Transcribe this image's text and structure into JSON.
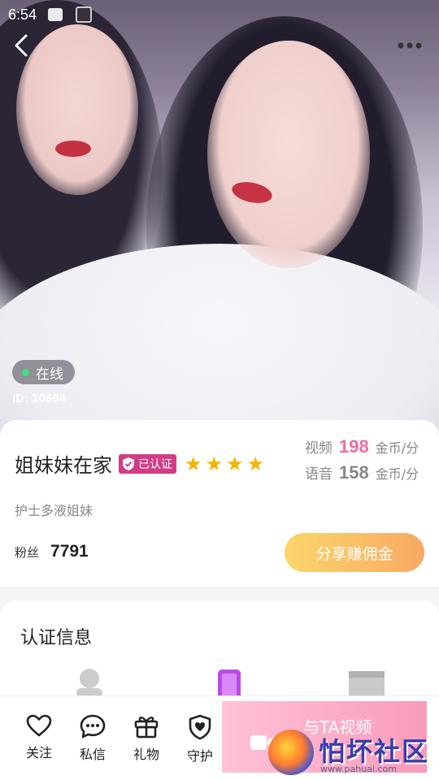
{
  "status_bar": {
    "time": "6:54"
  },
  "profile": {
    "online_status": "在线",
    "id_text": "ID: 10694",
    "name": "姐妹妹在家",
    "verified_label": "已认证",
    "star_count": 4,
    "stars": [
      "★",
      "★",
      "★",
      "★"
    ],
    "bio": "护士多液姐妹",
    "fans_label": "粉丝",
    "fans_count": "7791",
    "share_button": "分享赚佣金"
  },
  "pricing": {
    "video_label": "视频",
    "video_price": "198",
    "voice_label": "语音",
    "voice_price": "158",
    "unit": "金币/分"
  },
  "cert_section": {
    "title": "认证信息"
  },
  "bottom_bar": {
    "tabs": [
      {
        "label": "关注",
        "icon": "heart-icon"
      },
      {
        "label": "私信",
        "icon": "chat-bubble-icon"
      },
      {
        "label": "礼物",
        "icon": "gift-icon"
      },
      {
        "label": "守护",
        "icon": "shield-heart-icon"
      }
    ],
    "video_call_label": "与TA视频"
  },
  "watermark": {
    "text": "怕坏社区",
    "url": "www.pahuai.com"
  },
  "colors": {
    "accent_pink": "#f06b9c",
    "badge_magenta": "#d23c86",
    "star_gold": "#f5b400",
    "online_green": "#3ee07b"
  }
}
